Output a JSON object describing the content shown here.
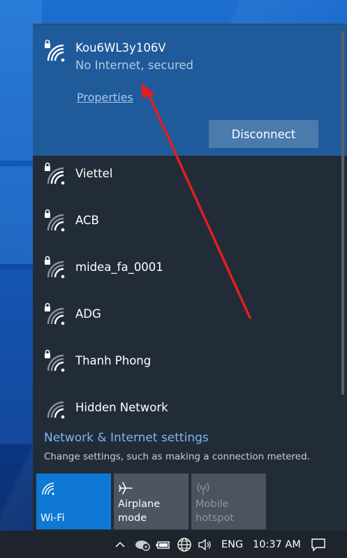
{
  "networks_connected": {
    "name": "Kou6WL3y106V",
    "status": "No Internet, secured",
    "properties_label": "Properties",
    "disconnect_label": "Disconnect"
  },
  "networks": [
    {
      "name": "Viettel",
      "secured": true
    },
    {
      "name": "ACB",
      "secured": true
    },
    {
      "name": "midea_fa_0001",
      "secured": true
    },
    {
      "name": "ADG",
      "secured": true
    },
    {
      "name": "Thanh Phong",
      "secured": true
    },
    {
      "name": "Hidden Network",
      "secured": false
    }
  ],
  "settings": {
    "link": "Network & Internet settings",
    "description": "Change settings, such as making a connection metered."
  },
  "quick_actions": [
    {
      "label": "Wi-Fi",
      "state": "on"
    },
    {
      "label": "Airplane mode",
      "state": "off"
    },
    {
      "label": "Mobile hotspot",
      "state": "disabled"
    }
  ],
  "taskbar": {
    "language": "ENG",
    "time": "10:37 AM"
  },
  "icons": [
    "wifi-secured-icon",
    "wifi-icon",
    "airplane-icon",
    "hotspot-icon",
    "chevron-up-icon",
    "onedrive-icon",
    "battery-icon",
    "globe-network-icon",
    "volume-icon",
    "action-center-icon"
  ],
  "colors": {
    "flyout_bg": "#222c38",
    "connected_bg": "#1f5a9a",
    "accent": "#0f78d4",
    "link": "#7fb5f0",
    "arrow": "#e01f1f"
  }
}
